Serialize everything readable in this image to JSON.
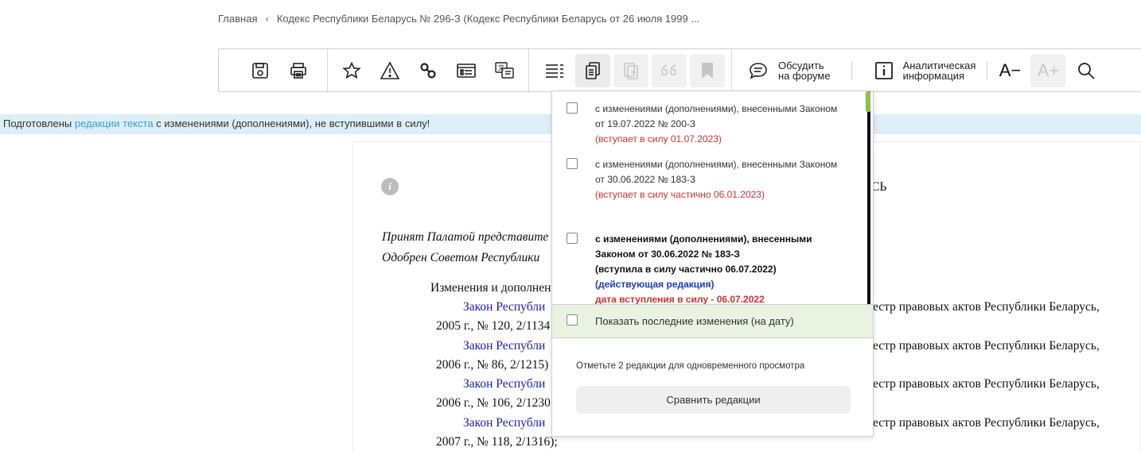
{
  "breadcrumb": {
    "home": "Главная",
    "separator": "‹",
    "current": "Кодекс Республики Беларусь № 296-З (Кодекс Республики Беларусь от 26 июля 1999 ..."
  },
  "toolbar": {
    "forum_line1": "Обсудить",
    "forum_line2": "на форуме",
    "analytics_line1": "Аналитическая",
    "analytics_line2": "информация",
    "font_decrease": "A−",
    "font_increase": "A+"
  },
  "notice": {
    "prefix": "Подготовлены ",
    "link": "редакции текста",
    "suffix": " с изменениями (дополнениями), не вступившими в силу!"
  },
  "document": {
    "info_icon": "i",
    "title_fragment": "СЬ",
    "adopted": "Принят Палатой представите",
    "approved": "Одобрен Советом Республики ",
    "changes_heading": "Изменения и дополнен",
    "entries": [
      {
        "link": "Закон Республи",
        "right": "естр правовых актов Республики Беларусь,",
        "cont": "2005 г., № 120, 2/1134"
      },
      {
        "link": "Закон Республи",
        "right": "естр правовых актов Республики Беларусь,",
        "cont": "2006 г., № 86, 2/1215)"
      },
      {
        "link": "Закон Республи",
        "right": "естр правовых актов Республики Беларусь,",
        "cont": "2006 г., № 106, 2/1230"
      },
      {
        "link": "Закон Республи",
        "right": "естр правовых актов Республики Беларусь,",
        "cont": "2007 г., № 118, 2/1316);"
      }
    ]
  },
  "dropdown": {
    "items": [
      {
        "line1": "с изменениями (дополнениями), внесенными Законом",
        "line2": "от 19.07.2022 № 200-З",
        "status": "(вступает в силу 01.07.2023)"
      },
      {
        "line1": "с изменениями (дополнениями), внесенными Законом",
        "line2": "от 30.06.2022 № 183-З",
        "status": "(вступает в силу частично 06.01.2023)"
      }
    ],
    "current": {
      "line1": "с изменениями (дополнениями), внесенными",
      "line2": "Законом от 30.06.2022 № 183-З",
      "line3": "(вступила в силу частично 06.07.2022)",
      "line4": "(действующая редакция)",
      "line5": "дата вступления в силу - 06.07.2022"
    },
    "show_latest": "Показать последние изменения (на дату)",
    "hint": "Отметьте 2 редакции для одновременного просмотра",
    "compare_button": "Сравнить редакции"
  },
  "colors": {
    "notice_bg": "#dceef6",
    "link_blue": "#3b9fd6",
    "status_red": "#e0312a",
    "scroll_thumb": "#8bc34a",
    "show_latest_bg": "#eaf3e2"
  },
  "icons": [
    "save-icon",
    "print-icon",
    "star-icon",
    "warning-icon",
    "link-icon",
    "card-icon",
    "translate-icon",
    "list-icon",
    "editions-icon",
    "export-icon",
    "quote-icon",
    "bookmark-icon",
    "forum-icon",
    "info-icon",
    "search-icon"
  ]
}
